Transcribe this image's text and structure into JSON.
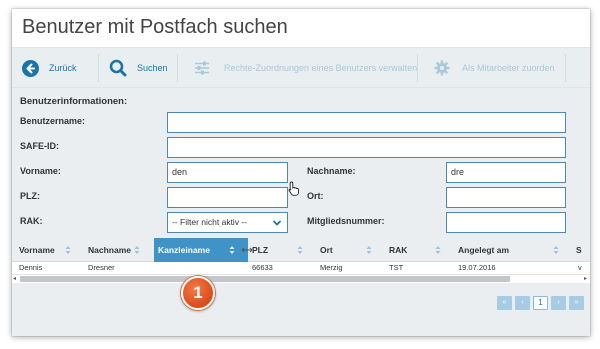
{
  "page": {
    "title": "Benutzer mit Postfach suchen"
  },
  "toolbar": {
    "back": {
      "label": "Zurück",
      "icon": "arrow-left-circle-icon"
    },
    "search": {
      "label": "Suchen",
      "icon": "search-icon"
    },
    "assign_rights": {
      "label": "Rechte-Zuordnungen eines Benutzers verwalten",
      "icon": "sliders-icon"
    },
    "assign_employee": {
      "label": "Als Mitarbeiter zuorden",
      "icon": "gear-icon"
    }
  },
  "form": {
    "section_title": "Benutzerinformationen:",
    "username": {
      "label": "Benutzername:",
      "value": ""
    },
    "safe_id": {
      "label": "SAFE-ID:",
      "value": ""
    },
    "first_name": {
      "label": "Vorname:",
      "value": "den"
    },
    "last_name": {
      "label": "Nachname:",
      "value": "dre"
    },
    "zip": {
      "label": "PLZ:",
      "value": ""
    },
    "city": {
      "label": "Ort:",
      "value": ""
    },
    "rak": {
      "label": "RAK:",
      "value": "-- Filter nicht aktiv --"
    },
    "member_number": {
      "label": "Mitgliedsnummer:",
      "value": ""
    }
  },
  "table": {
    "columns": [
      "Vorname",
      "Nachname",
      "Kanzleiname",
      "PLZ",
      "Ort",
      "RAK",
      "Angelegt am",
      "S"
    ],
    "rows": [
      [
        "Dennis",
        "Dresner",
        "",
        "66633",
        "Merzig",
        "TST",
        "19.07.2016",
        "v"
      ]
    ]
  },
  "annotation": {
    "badge_number": "1"
  },
  "pager": {
    "first": "«",
    "prev": "‹",
    "current": "1",
    "next": "›",
    "last": "»"
  },
  "colors": {
    "accent": "#1b73a8",
    "toolbar_bg": "#e9eef1",
    "panel_bg": "#eaeef1",
    "highlight_column": "#3f93c6",
    "badge": "#e0521f"
  }
}
